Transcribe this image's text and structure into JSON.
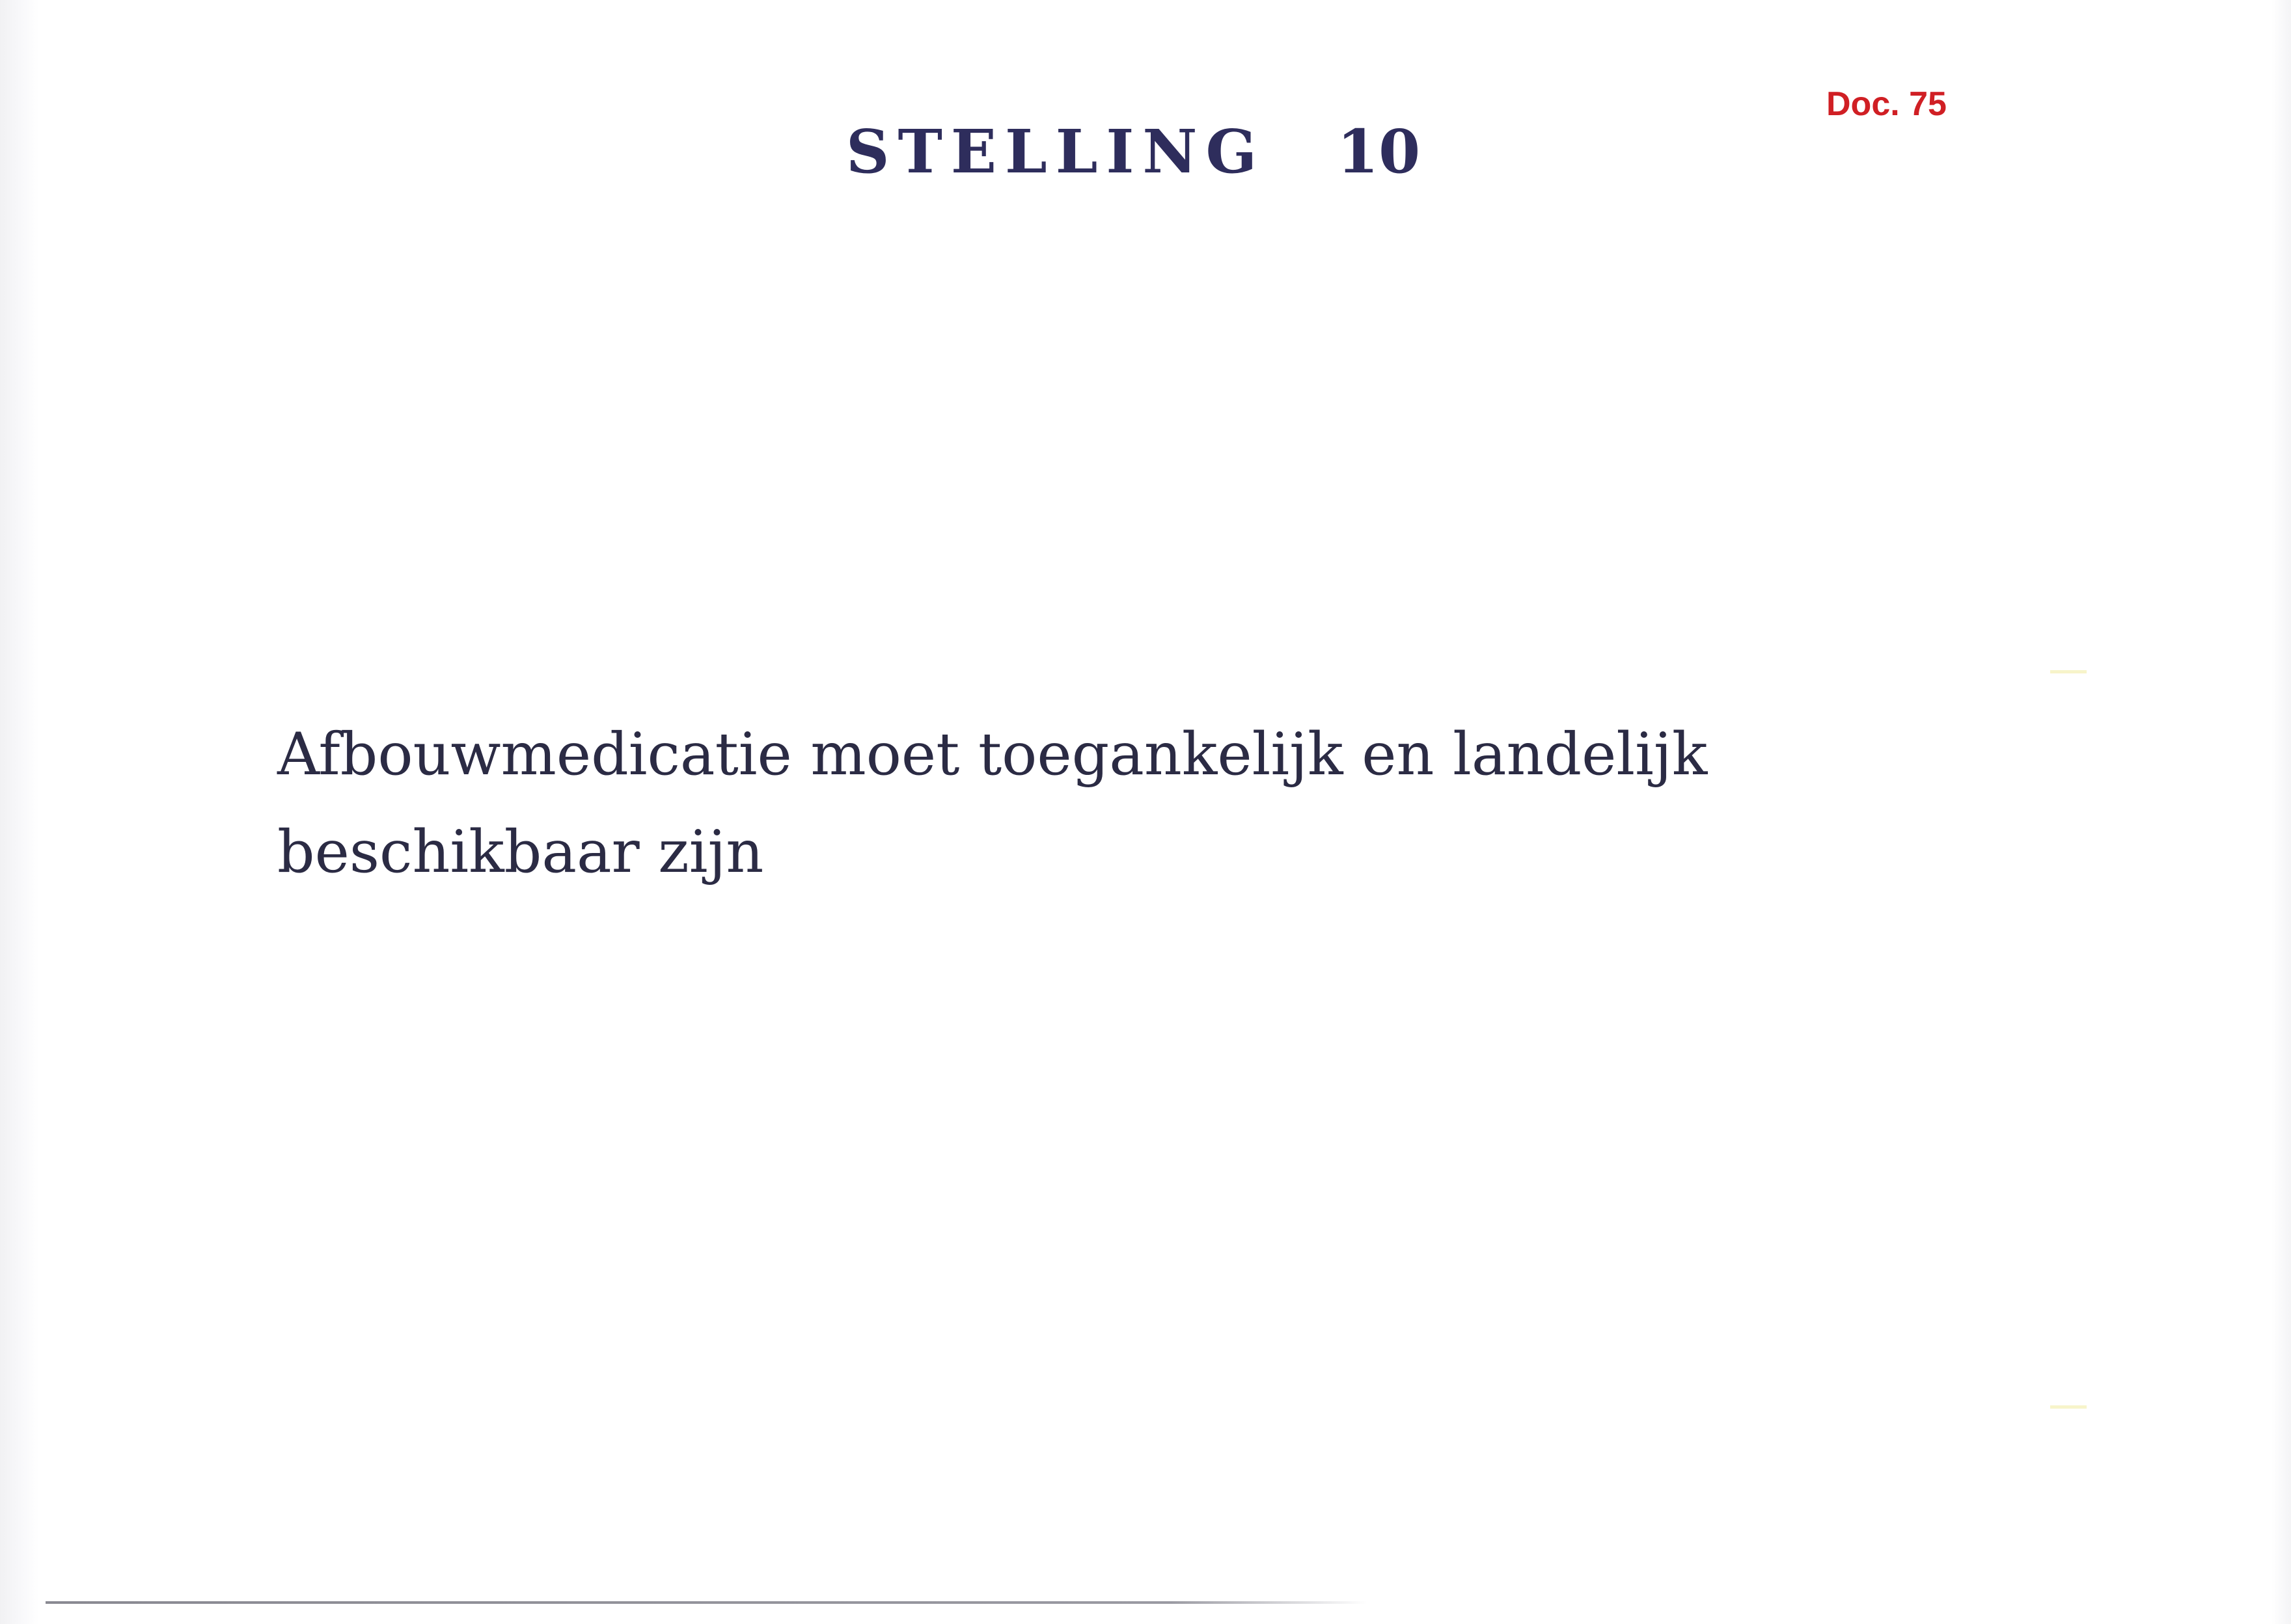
{
  "document": {
    "doc_label": "Doc. 75",
    "title_word": "STELLING",
    "title_number": "10",
    "statement_lines": [
      "Afbouwmedicatie moet toegankelijk en landelijk",
      "beschikbaar zijn"
    ]
  },
  "colors": {
    "page_background": "#ffffff",
    "title": "#2e2d5c",
    "doc_label": "#d01f24",
    "statement_text": "#2b2b44"
  }
}
